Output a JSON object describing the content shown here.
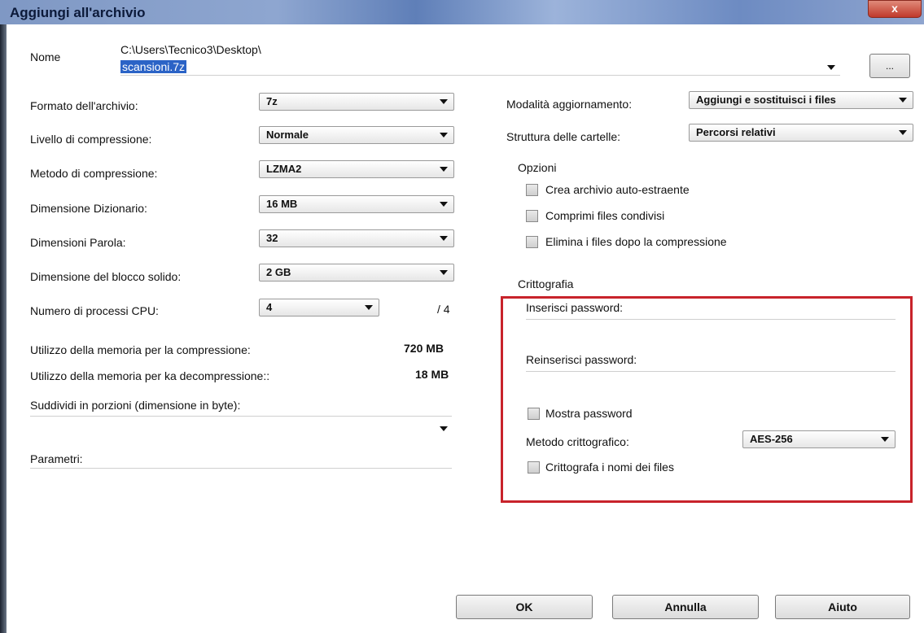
{
  "window": {
    "title": "Aggiungi all'archivio",
    "close_glyph": "x"
  },
  "name": {
    "label": "Nome",
    "path": "C:\\Users\\Tecnico3\\Desktop\\",
    "filename": "scansioni.7z",
    "browse_label": "..."
  },
  "left": {
    "format": {
      "label": "Formato dell'archivio:",
      "value": "7z"
    },
    "level": {
      "label": "Livello di compressione:",
      "value": "Normale"
    },
    "method": {
      "label": "Metodo di compressione:",
      "value": "LZMA2"
    },
    "dict": {
      "label": "Dimensione Dizionario:",
      "value": "16 MB"
    },
    "word": {
      "label": "Dimensioni Parola:",
      "value": "32"
    },
    "block": {
      "label": "Dimensione del blocco solido:",
      "value": "2 GB"
    },
    "cpu": {
      "label": "Numero di processi CPU:",
      "value": "4",
      "max": "/ 4"
    },
    "mem_comp": {
      "label": "Utilizzo della memoria per la compressione:",
      "value": "720 MB"
    },
    "mem_decomp": {
      "label": "Utilizzo della memoria per ka decompressione::",
      "value": "18 MB"
    },
    "split": {
      "label": "Suddividi in porzioni (dimensione in byte):",
      "value": ""
    },
    "params": {
      "label": "Parametri:",
      "value": ""
    }
  },
  "right": {
    "update_mode": {
      "label": "Modalità aggiornamento:",
      "value": "Aggiungi e sostituisci i files"
    },
    "folder_struct": {
      "label": "Struttura delle cartelle:",
      "value": "Percorsi relativi"
    },
    "options": {
      "title": "Opzioni",
      "items": [
        "Crea archivio auto-estraente",
        "Comprimi files condivisi",
        "Elimina i files dopo la compressione"
      ]
    },
    "encryption": {
      "title": "Crittografia",
      "password_label": "Inserisci password:",
      "repeat_label": "Reinserisci password:",
      "show_password": "Mostra password",
      "method_label": "Metodo crittografico:",
      "method_value": "AES-256",
      "encrypt_names": "Crittografa i nomi dei files"
    }
  },
  "buttons": {
    "ok": "OK",
    "cancel": "Annulla",
    "help": "Aiuto"
  },
  "colors": {
    "highlight": "#c8232b",
    "selection": "#2b63c6"
  }
}
